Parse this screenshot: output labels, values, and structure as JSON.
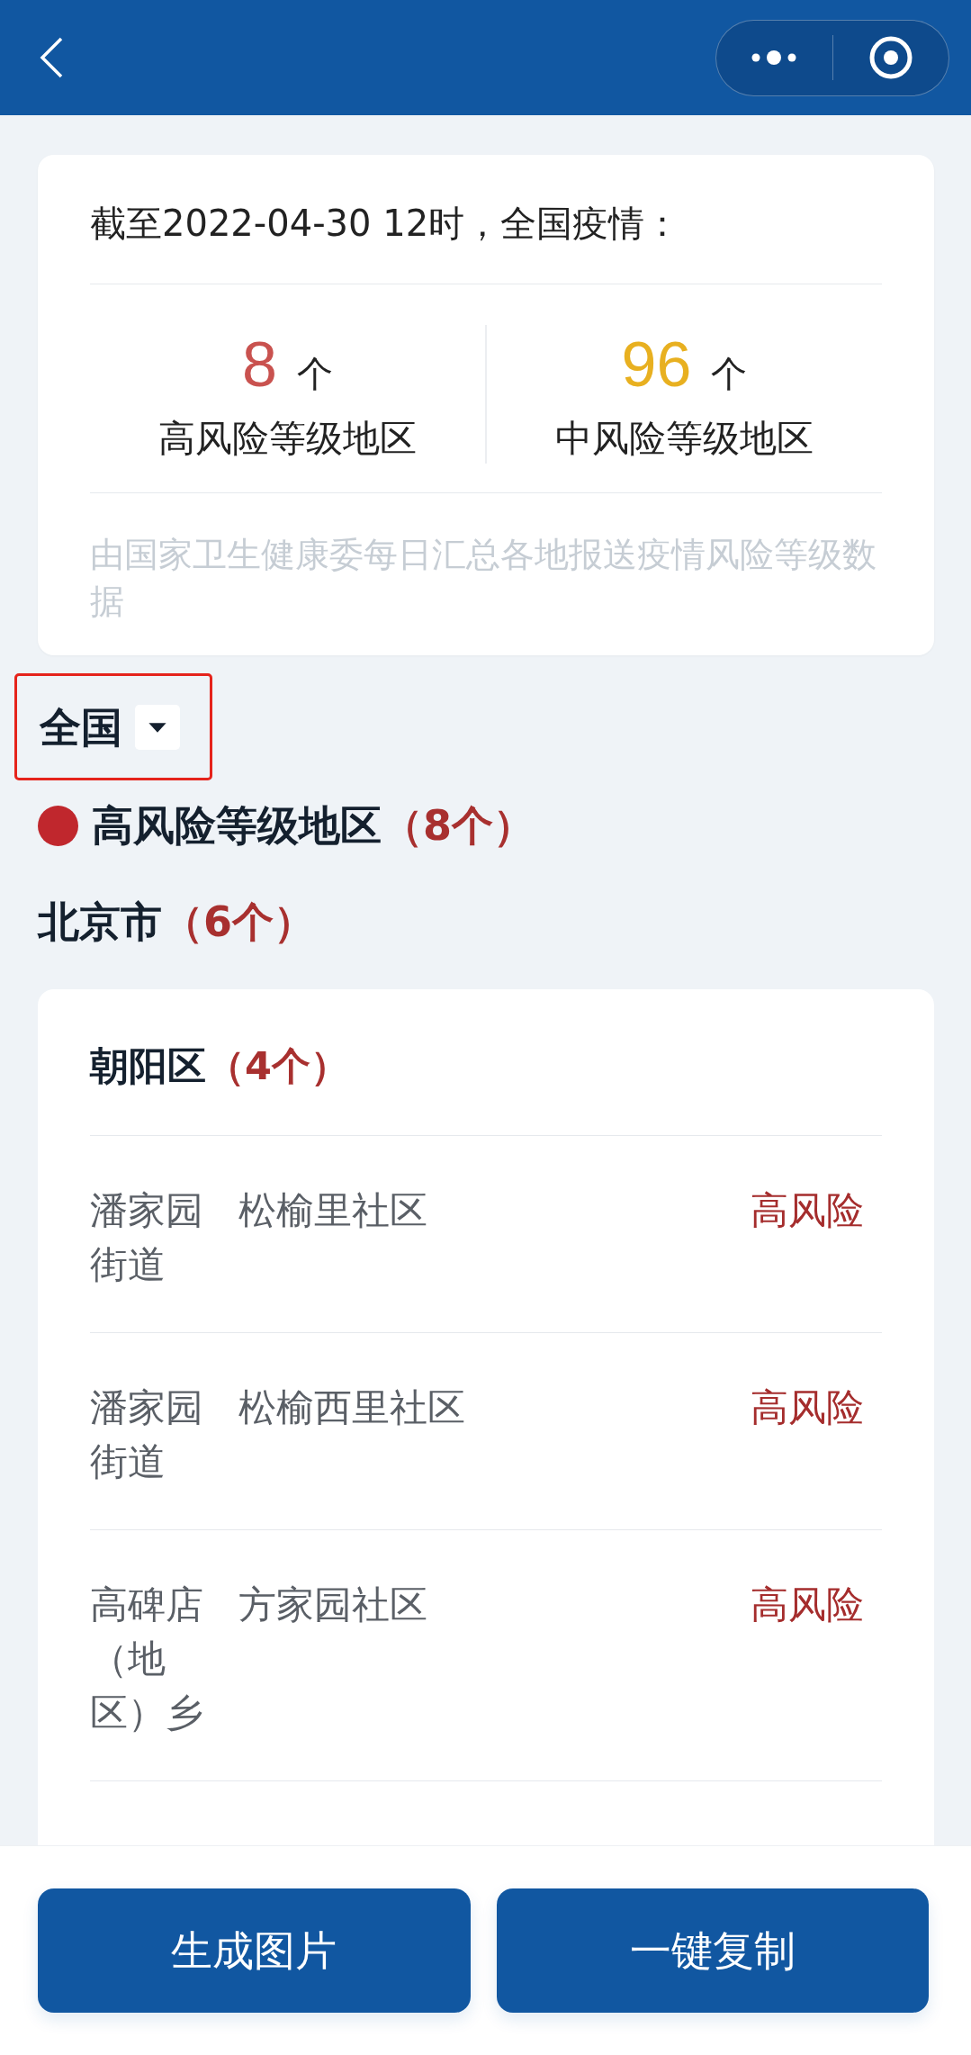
{
  "summary": {
    "title": "截至2022-04-30 12时，全国疫情：",
    "stats": [
      {
        "count": "8",
        "unit": "个",
        "label": "高风险等级地区",
        "color": "#c9524f"
      },
      {
        "count": "96",
        "unit": "个",
        "label": "中风险等级地区",
        "color": "#e8b020"
      }
    ],
    "note": "由国家卫生健康委每日汇总各地报送疫情风险等级数据"
  },
  "region_selector": {
    "label": "全国",
    "highlighted": true
  },
  "risk_level": {
    "kind": "high",
    "label": "高风险等级地区",
    "count": "（8个）"
  },
  "province": {
    "name": "北京市",
    "count": "（6个）"
  },
  "districts": [
    {
      "name": "朝阳区",
      "count": "（4个）",
      "areas": [
        {
          "street": "潘家园街道",
          "community": "松榆里社区",
          "risk": "高风险"
        },
        {
          "street": "潘家园街道",
          "community": "松榆西里社区",
          "risk": "高风险"
        },
        {
          "street": "高碑店（地区）乡",
          "community": "方家园社区",
          "risk": "高风险"
        }
      ]
    }
  ],
  "buttons": [
    "生成图片",
    "一键复制"
  ]
}
